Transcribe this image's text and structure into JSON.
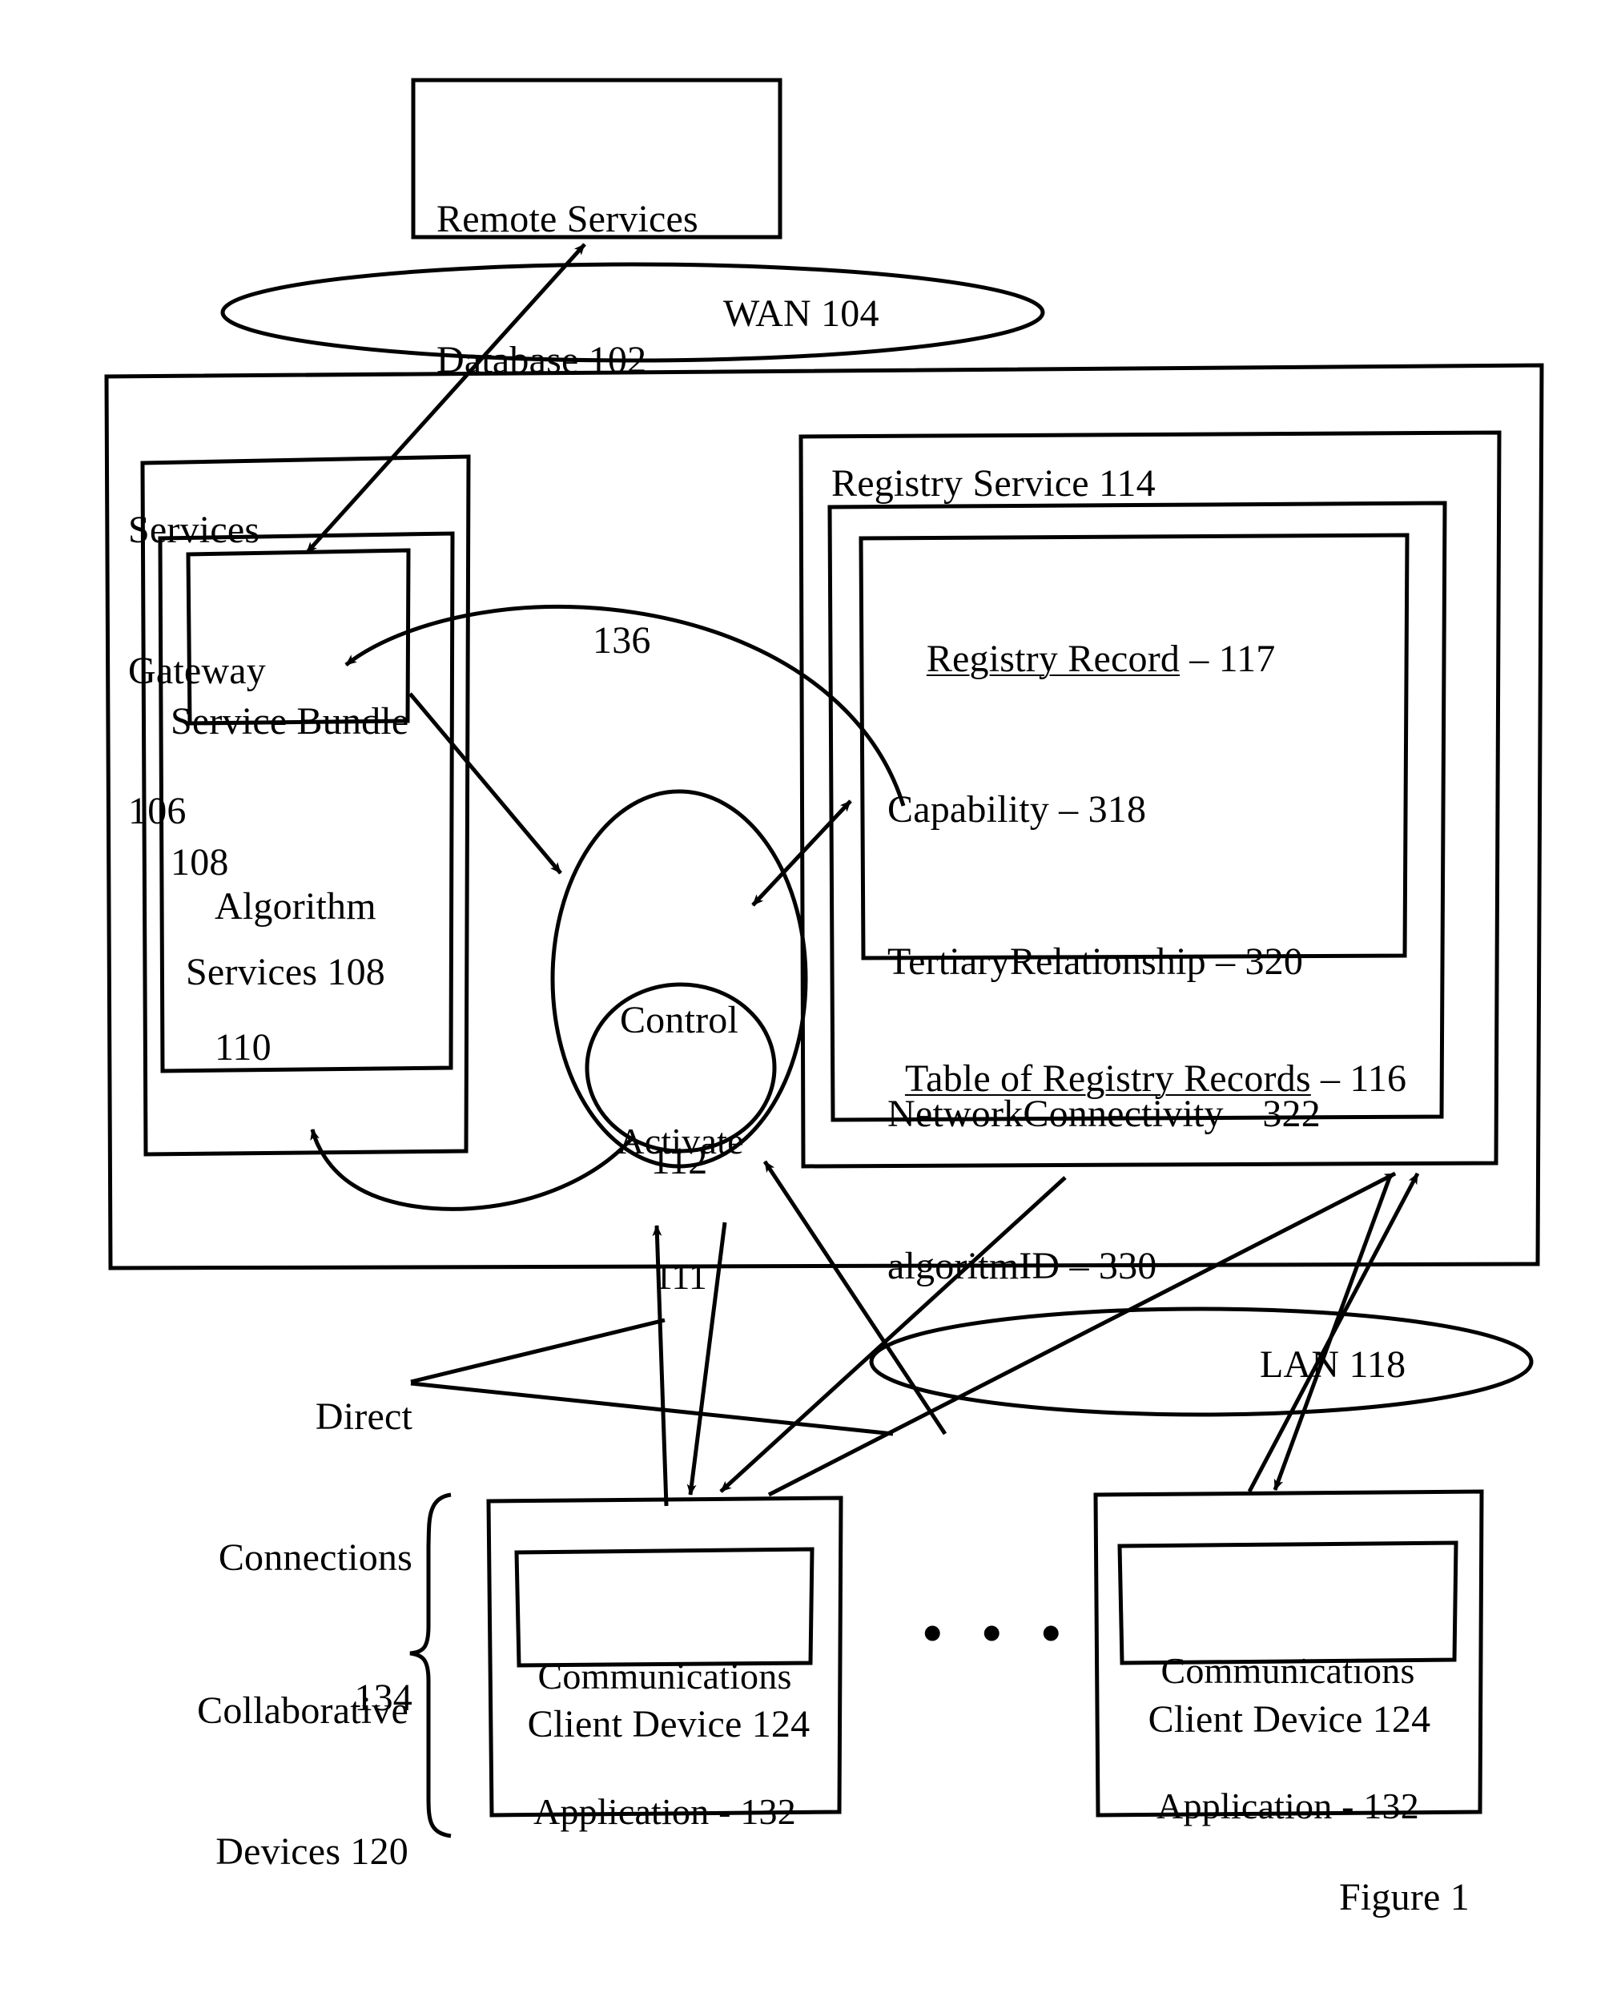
{
  "figure": {
    "caption": "Figure 1",
    "type": "patent-block-diagram"
  },
  "nodes": {
    "remote_db": {
      "line1": "Remote Services",
      "line2": "Database 102"
    },
    "wan": {
      "label": "WAN 104"
    },
    "services_gateway": {
      "line1": "Services",
      "line2": "Gateway",
      "line3": "106"
    },
    "service_bundle": {
      "line1": "Service Bundle",
      "line2": "108"
    },
    "services_inner": {
      "label": "Services 108"
    },
    "algorithm": {
      "line1": "Algorithm",
      "line2": "110"
    },
    "control": {
      "line1": "Control",
      "line2": "112"
    },
    "activate": {
      "line1": "Activate",
      "line2": "111"
    },
    "registry_service": {
      "label": "Registry Service 114"
    },
    "table_of_records": {
      "underlined": "Table of Registry Records",
      "suffix": " – 116"
    },
    "registry_record": {
      "title_underlined": "Registry Record",
      "title_suffix": " – 117",
      "fields": [
        "Capability – 318",
        "TertiaryRelationship – 320",
        "NetworkConnectivity – 322",
        "algoritmID – 330"
      ]
    },
    "lan": {
      "label": "LAN 118"
    },
    "direct_connections": {
      "line1": "Direct",
      "line2": "Connections",
      "line3": "134"
    },
    "collaborative_devices": {
      "line1": "Collaborative",
      "line2": "Devices 120"
    },
    "client_device_left": {
      "app_line1": "Communications",
      "app_line2": "Application - 132",
      "label": "Client Device 124"
    },
    "client_device_right": {
      "app_line1": "Communications",
      "app_line2": "Application - 132",
      "label": "Client Device 124"
    },
    "ellipsis": {
      "label": "• • •"
    },
    "link_136": {
      "label": "136"
    }
  },
  "colors": {
    "stroke": "#000000",
    "background": "#ffffff"
  }
}
